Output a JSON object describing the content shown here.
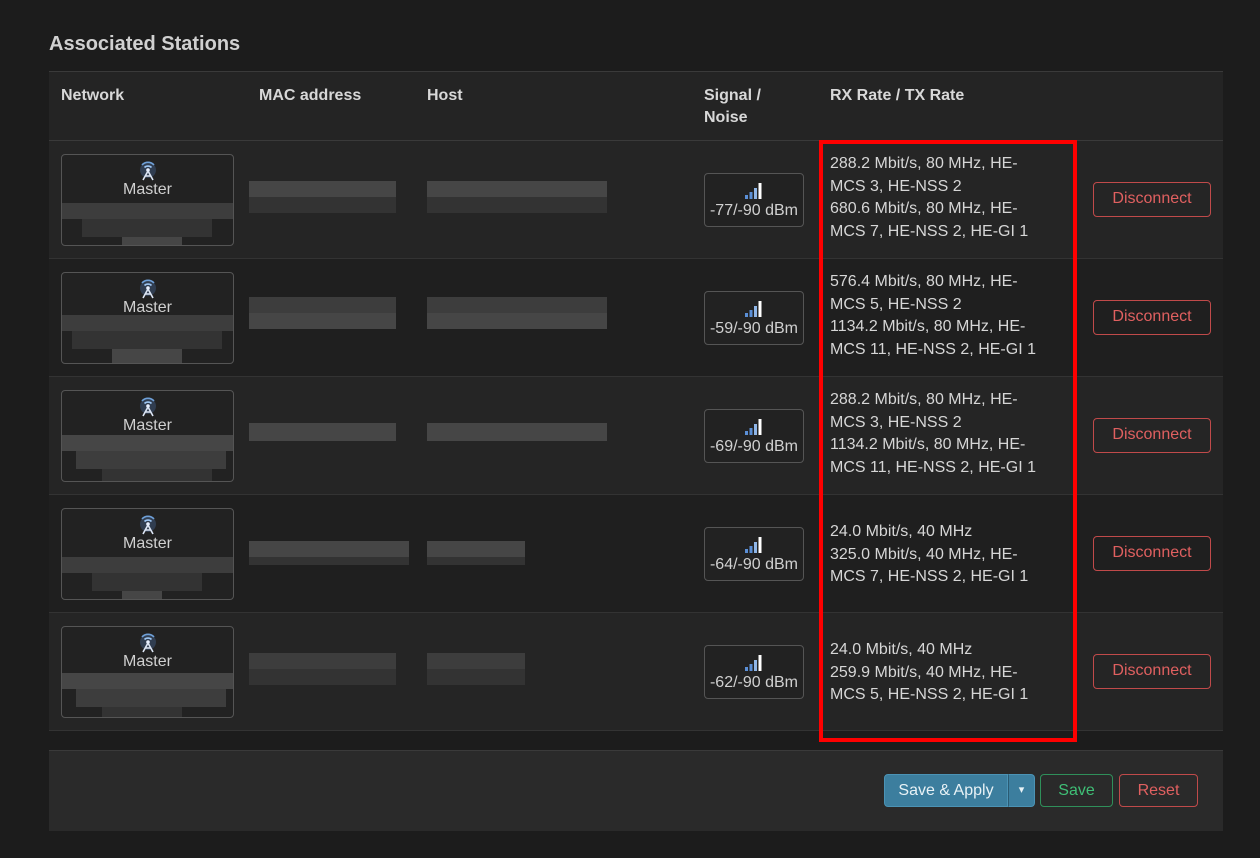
{
  "section": {
    "title": "Associated Stations"
  },
  "table": {
    "headers": {
      "network": "Network",
      "mac": "MAC address",
      "host": "Host",
      "signal_line1": "Signal /",
      "signal_line2": "Noise",
      "rate": "RX Rate / TX Rate"
    },
    "rows": [
      {
        "mode": "Master",
        "signal": "-77/-90 dBm",
        "rate_lines": [
          "288.2 Mbit/s, 80 MHz, HE-",
          "MCS 3, HE-NSS 2",
          "680.6 Mbit/s, 80 MHz, HE-",
          "MCS 7, HE-NSS 2, HE-GI 1"
        ],
        "disconnect": "Disconnect"
      },
      {
        "mode": "Master",
        "signal": "-59/-90 dBm",
        "rate_lines": [
          "576.4 Mbit/s, 80 MHz, HE-",
          "MCS 5, HE-NSS 2",
          "1134.2 Mbit/s, 80 MHz, HE-",
          "MCS 11, HE-NSS 2, HE-GI 1"
        ],
        "disconnect": "Disconnect"
      },
      {
        "mode": "Master",
        "signal": "-69/-90 dBm",
        "rate_lines": [
          "288.2 Mbit/s, 80 MHz, HE-",
          "MCS 3, HE-NSS 2",
          "1134.2 Mbit/s, 80 MHz, HE-",
          "MCS 11, HE-NSS 2, HE-GI 1"
        ],
        "disconnect": "Disconnect"
      },
      {
        "mode": "Master",
        "signal": "-64/-90 dBm",
        "rate_lines": [
          "24.0 Mbit/s, 40 MHz",
          "325.0 Mbit/s, 40 MHz, HE-",
          "MCS 7, HE-NSS 2, HE-GI 1"
        ],
        "disconnect": "Disconnect"
      },
      {
        "mode": "Master",
        "signal": "-62/-90 dBm",
        "rate_lines": [
          "24.0 Mbit/s, 40 MHz",
          "259.9 Mbit/s, 40 MHz, HE-",
          "MCS 5, HE-NSS 2, HE-GI 1"
        ],
        "disconnect": "Disconnect"
      }
    ]
  },
  "footer": {
    "save_apply": "Save & Apply",
    "dropdown_arrow": "▾",
    "save": "Save",
    "reset": "Reset"
  },
  "colors": {
    "accent_blue": "#3c7e9e",
    "save_green": "#3fbf76",
    "danger_red": "#e06060",
    "highlight": "#ff0000"
  },
  "icons": {
    "network": "wifi-antenna-icon",
    "signal": "signal-bars-icon"
  }
}
